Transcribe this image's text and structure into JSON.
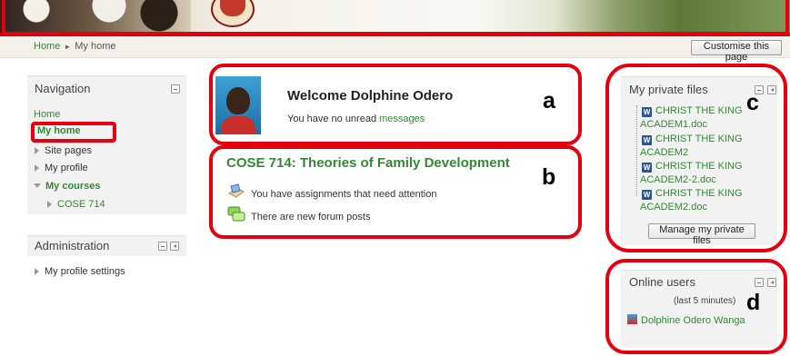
{
  "banner": {
    "tagline": ""
  },
  "breadcrumb": {
    "home": "Home",
    "separator": "►",
    "current": "My home"
  },
  "customise_button": "Customise this page",
  "navigation": {
    "title": "Navigation",
    "home": "Home",
    "my_home": "My home",
    "site_pages": "Site pages",
    "my_profile": "My profile",
    "my_courses": "My courses",
    "course": "COSE 714"
  },
  "administration": {
    "title": "Administration",
    "profile_settings": "My profile settings"
  },
  "welcome": {
    "title": "Welcome Dolphine Odero",
    "unread_prefix": "You have no unread",
    "messages_link": "messages"
  },
  "course": {
    "title": "COSE 714: Theories of Family Development",
    "assignments_notice": "You have assignments that need attention",
    "forum_notice": "There are new forum posts"
  },
  "private_files": {
    "title": "My private files",
    "files": [
      {
        "line1": "CHRIST THE KING",
        "line2": "ACADEM1.doc"
      },
      {
        "line1": "CHRIST THE KING",
        "line2": "ACADEM2"
      },
      {
        "line1": "CHRIST THE KING",
        "line2": "ACADEM2-2.doc"
      },
      {
        "line1": "CHRIST THE KING",
        "line2": "ACADEM2.doc"
      }
    ],
    "word_icon_letter": "W",
    "manage_button": "Manage my private files"
  },
  "online_users": {
    "title": "Online users",
    "period": "(last 5 minutes)",
    "user": "Dolphine Odero Wanga"
  },
  "annotations": {
    "a": "a",
    "b": "b",
    "c": "c",
    "d": "d"
  },
  "colors": {
    "link_green": "#338833",
    "annotation_red": "#e4000f",
    "banner_red": "#d4000f"
  }
}
